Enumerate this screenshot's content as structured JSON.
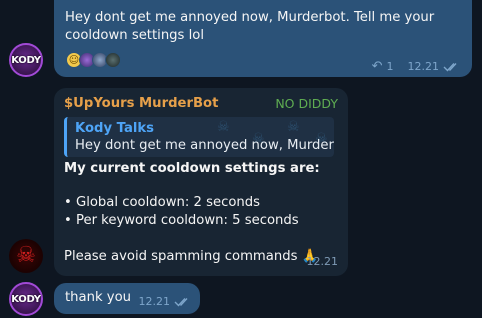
{
  "messages": [
    {
      "id": "m1",
      "direction": "outgoing",
      "text": "Hey dont get me annoyed now, Murderbot. Tell me your cooldown settings lol",
      "reactions": [
        "grinning-emoji",
        "user-avatar",
        "user-avatar",
        "user-avatar"
      ],
      "reply_count": "1",
      "time": "12.21",
      "status": "read"
    },
    {
      "id": "m2",
      "direction": "incoming",
      "sender": "$UpYours MurderBot",
      "sender_tag": "NO DIDDY",
      "quote": {
        "name": "Kody Talks",
        "text": "Hey dont get me annoyed now, Murderb..."
      },
      "lines": [
        "My current cooldown settings are:",
        "• Global cooldown: 2 seconds",
        "• Per keyword cooldown: 5 seconds",
        "Please avoid spamming commands 🙏"
      ],
      "time": "12.21"
    },
    {
      "id": "m3",
      "direction": "outgoing",
      "text": "thank you",
      "time": "12.21",
      "status": "read"
    }
  ],
  "avatars": {
    "kody_label": "KODY"
  },
  "colors": {
    "background": "#0e1621",
    "outgoing_bubble": "#2b5278",
    "incoming_bubble": "#182533",
    "sender_name": "#e6a04a",
    "sender_tag": "#5fad52",
    "quote_accent": "#4ea4f6"
  }
}
